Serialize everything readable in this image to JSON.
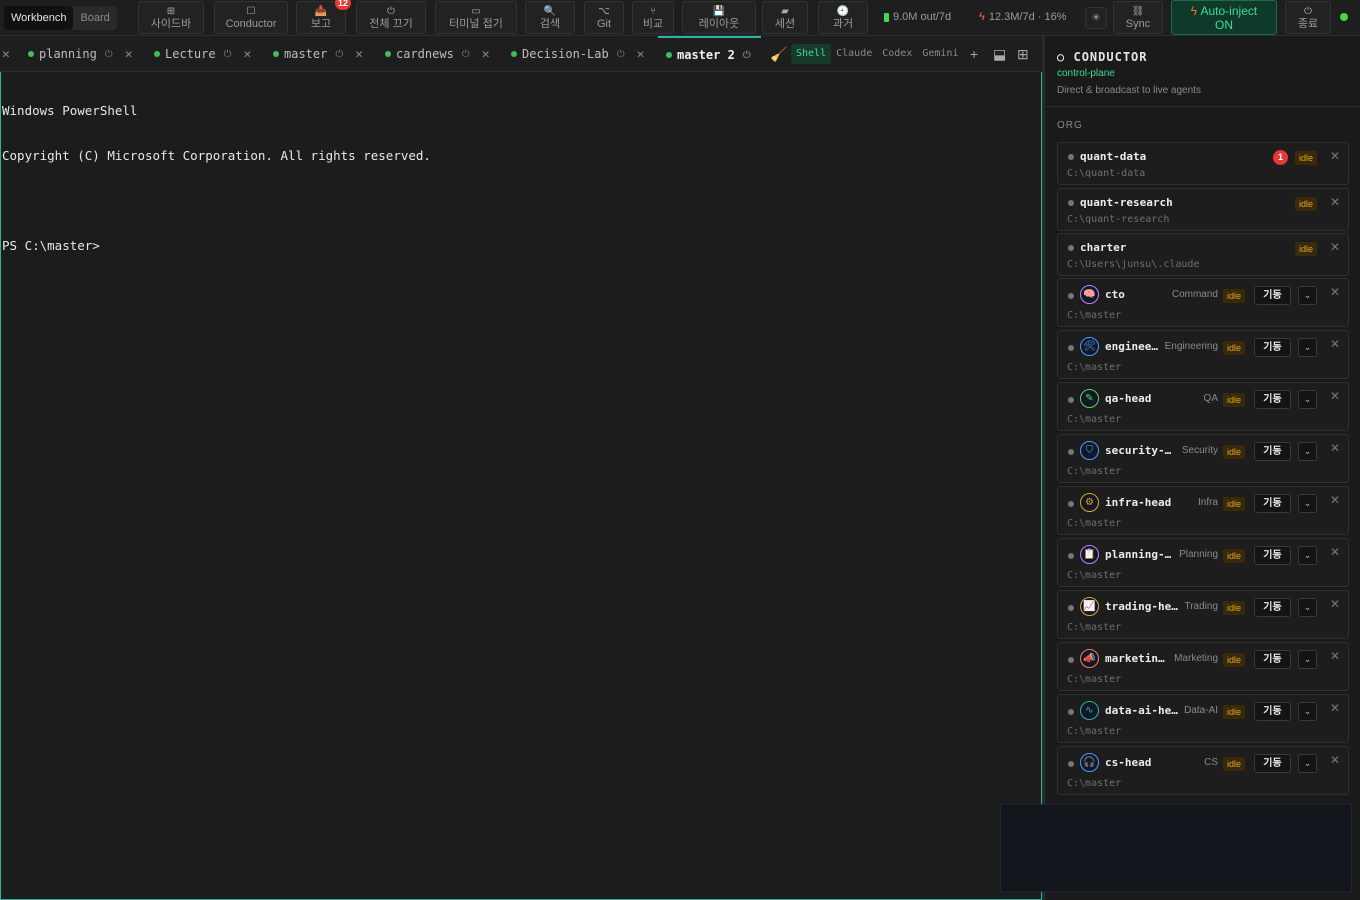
{
  "topbar": {
    "view_tabs": [
      "Workbench",
      "Board"
    ],
    "buttons": [
      {
        "name": "sidebar-button",
        "icon": "⊞",
        "label": "사이드바"
      },
      {
        "name": "conductor-button",
        "icon": "☐",
        "label": "Conductor"
      },
      {
        "name": "report-button",
        "icon": "📥",
        "label": "보고",
        "badge": "12"
      },
      {
        "name": "terminate-all-button",
        "icon": "⏻",
        "label": "전체 끄기"
      },
      {
        "name": "collapse-terminal-button",
        "icon": "▭",
        "label": "터미널 접기"
      },
      {
        "name": "search-button",
        "icon": "🔍",
        "label": "검색"
      },
      {
        "name": "git-button",
        "icon": "⌥",
        "label": "Git"
      },
      {
        "name": "compare-button",
        "icon": "⑂",
        "label": "비교"
      },
      {
        "name": "layout-button",
        "icon": "💾",
        "label": "레이아웃"
      },
      {
        "name": "session-button",
        "icon": "▰",
        "label": "세션"
      },
      {
        "name": "history-button",
        "icon": "🕘",
        "label": "과거"
      },
      {
        "name": "sync-button",
        "icon": "⛓",
        "label": "Sync"
      },
      {
        "name": "exit-button",
        "icon": "⏻",
        "label": "종료"
      }
    ],
    "token_stat": "9.0M out/7d",
    "usage_stat": "12.3M/7d · 16%",
    "auto_inject": {
      "label": "Auto-inject",
      "state": "ON"
    }
  },
  "tabs": {
    "items": [
      {
        "label": "planning"
      },
      {
        "label": "Lecture"
      },
      {
        "label": "master"
      },
      {
        "label": "cardnews"
      },
      {
        "label": "Decision-Lab"
      },
      {
        "label": "master 2",
        "active": true
      }
    ],
    "agent_modes": [
      "Shell",
      "Claude",
      "Codex",
      "Gemini"
    ],
    "active_mode": "Shell"
  },
  "terminal": {
    "lines": [
      "Windows PowerShell",
      "Copyright (C) Microsoft Corporation. All rights reserved.",
      "",
      "PS C:\\master>"
    ]
  },
  "conductor": {
    "title": "CONDUCTOR",
    "subtitle": "control-plane",
    "description": "Direct & broadcast to live agents",
    "section_label": "ORG",
    "projects": [
      {
        "name": "quant-data",
        "path": "C:\\quant-data",
        "status": "idle",
        "alert": "1"
      },
      {
        "name": "quant-research",
        "path": "C:\\quant-research",
        "status": "idle"
      },
      {
        "name": "charter",
        "path": "C:\\Users\\junsu\\.claude",
        "status": "idle"
      }
    ],
    "start_label": "기동",
    "agents": [
      {
        "name": "cto",
        "role": "Command",
        "path": "C:\\master",
        "status": "idle",
        "icon": "brain-icon",
        "glyph": "🧠",
        "accent": "#c77dff"
      },
      {
        "name": "enginee…",
        "role": "Engineering",
        "path": "C:\\master",
        "status": "idle",
        "icon": "tools-icon",
        "glyph": "🛠",
        "accent": "#4a9eff"
      },
      {
        "name": "qa-head",
        "role": "QA",
        "path": "C:\\master",
        "status": "idle",
        "icon": "pen-icon",
        "glyph": "✎",
        "accent": "#5fd35f"
      },
      {
        "name": "security-…",
        "role": "Security",
        "path": "C:\\master",
        "status": "idle",
        "icon": "shield-icon",
        "glyph": "⛉",
        "accent": "#4a9eff"
      },
      {
        "name": "infra-head",
        "role": "Infra",
        "path": "C:\\master",
        "status": "idle",
        "icon": "gear-icon",
        "glyph": "⚙",
        "accent": "#e0a526"
      },
      {
        "name": "planning-…",
        "role": "Planning",
        "path": "C:\\master",
        "status": "idle",
        "icon": "clipboard-icon",
        "glyph": "📋",
        "accent": "#c77dff"
      },
      {
        "name": "trading-he…",
        "role": "Trading",
        "path": "C:\\master",
        "status": "idle",
        "icon": "chart-icon",
        "glyph": "📈",
        "accent": "#e0a526"
      },
      {
        "name": "marketin…",
        "role": "Marketing",
        "path": "C:\\master",
        "status": "idle",
        "icon": "megaphone-icon",
        "glyph": "📣",
        "accent": "#ff7b54"
      },
      {
        "name": "data-ai-he…",
        "role": "Data-AI",
        "path": "C:\\master",
        "status": "idle",
        "icon": "data-icon",
        "glyph": "∿",
        "accent": "#2bb3a3"
      },
      {
        "name": "cs-head",
        "role": "CS",
        "path": "C:\\master",
        "status": "idle",
        "icon": "headset-icon",
        "glyph": "🎧",
        "accent": "#4a9eff"
      }
    ]
  }
}
